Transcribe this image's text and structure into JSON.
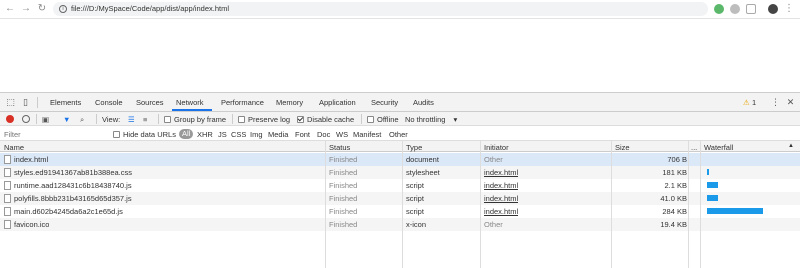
{
  "browser": {
    "url": "file:///D:/MySpace/Code/app/dist/app/index.html"
  },
  "devtools": {
    "tabs": [
      "Elements",
      "Console",
      "Sources",
      "Network",
      "Performance",
      "Memory",
      "Application",
      "Security",
      "Audits"
    ],
    "active_tab": "Network",
    "warning_count": "1",
    "toolbar": {
      "view_label": "View:",
      "group_by_frame": "Group by frame",
      "preserve_log": "Preserve log",
      "disable_cache": "Disable cache",
      "offline": "Offline",
      "throttling": "No throttling"
    },
    "filter": {
      "placeholder": "Filter",
      "hide_data_urls": "Hide data URLs",
      "types": [
        "All",
        "XHR",
        "JS",
        "CSS",
        "Img",
        "Media",
        "Font",
        "Doc",
        "WS",
        "Manifest",
        "Other"
      ]
    },
    "columns": [
      "Name",
      "Status",
      "Type",
      "Initiator",
      "Size",
      "...",
      "Waterfall"
    ],
    "requests": [
      {
        "name": "index.html",
        "status": "Finished",
        "type": "document",
        "initiator": "Other",
        "size": "706 B",
        "wf_start": 0.0,
        "wf_len": 0.0
      },
      {
        "name": "styles.ed91941367ab81b388ea.css",
        "status": "Finished",
        "type": "stylesheet",
        "initiator": "index.html",
        "size": "181 KB",
        "wf_start": 0.02,
        "wf_len": 0.03
      },
      {
        "name": "runtime.aad128431c6b18438740.js",
        "status": "Finished",
        "type": "script",
        "initiator": "index.html",
        "size": "2.1 KB",
        "wf_start": 0.02,
        "wf_len": 0.12
      },
      {
        "name": "polyfills.8bbb231b43165d65d357.js",
        "status": "Finished",
        "type": "script",
        "initiator": "index.html",
        "size": "41.0 KB",
        "wf_start": 0.02,
        "wf_len": 0.12
      },
      {
        "name": "main.d602b4245da6a2c1e65d.js",
        "status": "Finished",
        "type": "script",
        "initiator": "index.html",
        "size": "284 KB",
        "wf_start": 0.02,
        "wf_len": 0.62
      },
      {
        "name": "favicon.ico",
        "status": "Finished",
        "type": "x-icon",
        "initiator": "Other",
        "size": "19.4 KB",
        "wf_start": 0.0,
        "wf_len": 0.0
      }
    ],
    "colors": {
      "accent": "#1a73e8",
      "bar": "#1a9ae8"
    }
  }
}
